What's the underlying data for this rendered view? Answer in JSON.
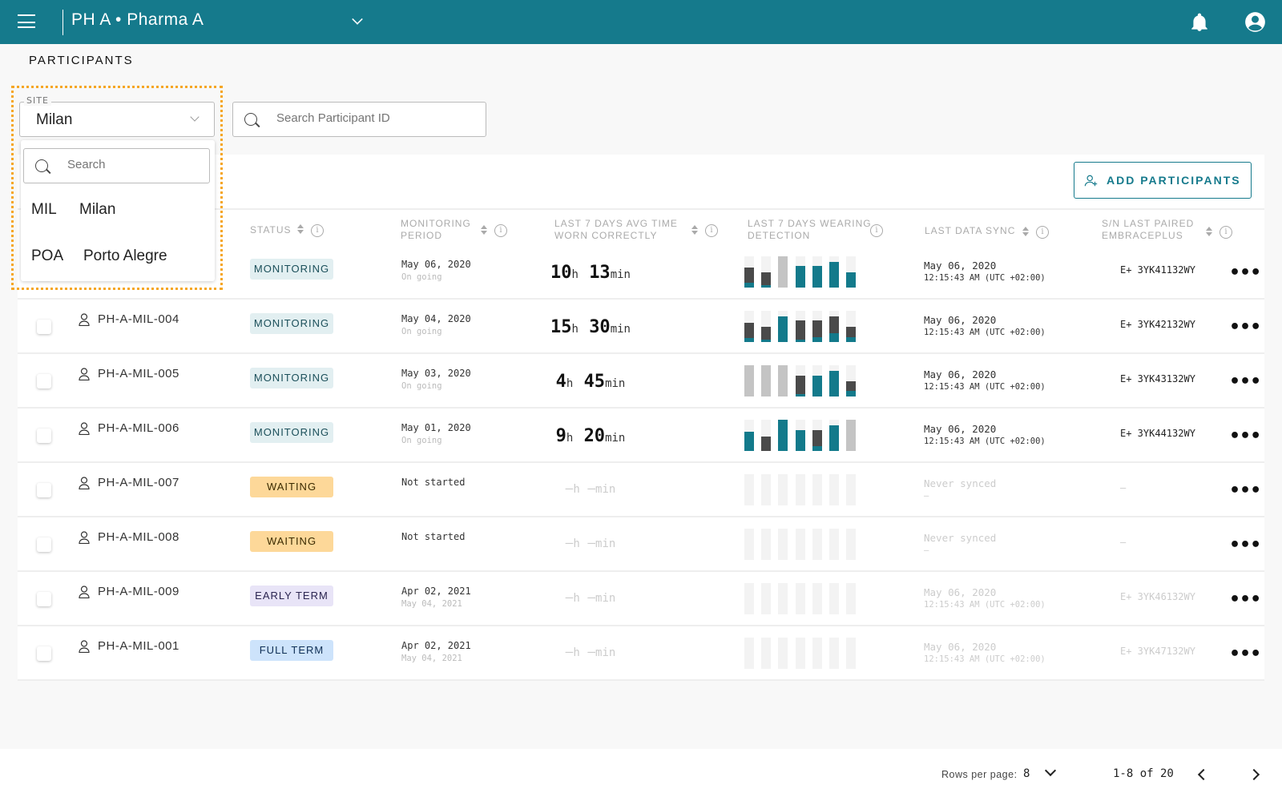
{
  "header": {
    "org": "PH A • Pharma A",
    "menu_icon": "hamburger-icon",
    "notification_icon": "bell-icon",
    "account_icon": "account-circle-icon"
  },
  "page": {
    "title": "PARTICIPANTS"
  },
  "filters": {
    "site_label": "SITE",
    "site_value": "Milan",
    "search_placeholder": "Search Participant ID"
  },
  "site_dropdown": {
    "search_placeholder": "Search",
    "options": [
      {
        "code": "MIL",
        "name": "Milan"
      },
      {
        "code": "POA",
        "name": "Porto Alegre"
      }
    ]
  },
  "toolbar": {
    "add_label": "ADD PARTICIPANTS"
  },
  "columns": {
    "status": "STATUS",
    "monitoring": "MONITORING PERIOD",
    "time_worn": "LAST 7 DAYS AVG TIME WORN CORRECTLY",
    "wearing": "LAST 7 DAYS WEARING DETECTION",
    "sync": "LAST DATA SYNC",
    "sn": "S/N LAST PAIRED EMBRACEPLUS"
  },
  "colors": {
    "brand": "#157a8c",
    "teal": "#137a8b",
    "dark": "#4a4a4a",
    "nodata": "#c4c4c4",
    "highlight": "#f5a623"
  },
  "status_styles": {
    "MONITORING": {
      "bg": "#e2eff1",
      "fg": "#1b4f5a"
    },
    "WAITING": {
      "bg": "#fdd899",
      "fg": "#3a2a00"
    },
    "EARLY TERM": {
      "bg": "#e8e4f7",
      "fg": "#2a2450"
    },
    "FULL TERM": {
      "bg": "#cde3fb",
      "fg": "#0f2f55"
    }
  },
  "rows": [
    {
      "id": "",
      "status": "MONITORING",
      "period": "May 06, 2020",
      "period_sub": "On going",
      "hours": "10",
      "mins": "13",
      "sync": "May 06, 2020",
      "sync_sub": "12:15:43 AM (UTC +02:00)",
      "sn": "E+ 3YK41132WY",
      "dim": false,
      "bars": [
        {
          "total": 0.64,
          "teal": 0.15
        },
        {
          "total": 0.49,
          "teal": 0.08
        },
        {
          "nodata": true
        },
        {
          "total": 0.69,
          "teal": 0.69
        },
        {
          "total": 0.69,
          "teal": 0.69
        },
        {
          "total": 0.83,
          "teal": 0.83
        },
        {
          "total": 0.49,
          "teal": 0.49
        }
      ]
    },
    {
      "id": "PH-A-MIL-004",
      "status": "MONITORING",
      "period": "May 04, 2020",
      "period_sub": "On going",
      "hours": "15",
      "mins": "30",
      "sync": "May 06, 2020",
      "sync_sub": "12:15:43 AM (UTC +02:00)",
      "sn": "E+ 3YK42132WY",
      "dim": false,
      "bars": [
        {
          "total": 0.62,
          "teal": 0.14
        },
        {
          "total": 0.48,
          "teal": 0.09
        },
        {
          "total": 0.82,
          "teal": 0.82
        },
        {
          "total": 0.69,
          "teal": 0.09
        },
        {
          "total": 0.69,
          "teal": 0.15
        },
        {
          "total": 0.82,
          "teal": 0.29
        },
        {
          "total": 0.48,
          "teal": 0.15
        }
      ]
    },
    {
      "id": "PH-A-MIL-005",
      "status": "MONITORING",
      "period": "May 03, 2020",
      "period_sub": "On going",
      "hours": "4",
      "mins": "45",
      "sync": "May 06, 2020",
      "sync_sub": "12:15:43 AM (UTC +02:00)",
      "sn": "E+ 3YK43132WY",
      "dim": false,
      "bars": [
        {
          "nodata": true
        },
        {
          "nodata": true
        },
        {
          "nodata": true
        },
        {
          "total": 0.67,
          "teal": 0.09
        },
        {
          "total": 0.67,
          "teal": 0.67
        },
        {
          "total": 0.82,
          "teal": 0.82
        },
        {
          "total": 0.49,
          "teal": 0.17
        }
      ]
    },
    {
      "id": "PH-A-MIL-006",
      "status": "MONITORING",
      "period": "May 01, 2020",
      "period_sub": "On going",
      "hours": "9",
      "mins": "20",
      "sync": "May 06, 2020",
      "sync_sub": "12:15:43 AM (UTC +02:00)",
      "sn": "E+ 3YK44132WY",
      "dim": false,
      "bars": [
        {
          "total": 0.62,
          "teal": 0.62
        },
        {
          "total": 0.47,
          "teal": 0
        },
        {
          "total": 0.99,
          "teal": 0.99
        },
        {
          "total": 0.67,
          "teal": 0.67
        },
        {
          "total": 0.67,
          "teal": 0.15
        },
        {
          "total": 0.82,
          "teal": 0.82
        },
        {
          "nodata": true
        }
      ]
    },
    {
      "id": "PH-A-MIL-007",
      "status": "WAITING",
      "period": "Not started",
      "period_sub": "",
      "hours": "–",
      "mins": "–",
      "sync": "Never synced",
      "sync_sub": "–",
      "sn": "–",
      "dim": true,
      "bars": []
    },
    {
      "id": "PH-A-MIL-008",
      "status": "WAITING",
      "period": "Not started",
      "period_sub": "",
      "hours": "–",
      "mins": "–",
      "sync": "Never synced",
      "sync_sub": "–",
      "sn": "–",
      "dim": true,
      "bars": []
    },
    {
      "id": "PH-A-MIL-009",
      "status": "EARLY TERM",
      "period": "Apr 02, 2021",
      "period_sub": "May 04, 2021",
      "hours": "–",
      "mins": "–",
      "sync": "May 06, 2020",
      "sync_sub": "12:15:43 AM (UTC +02:00)",
      "sn": "E+ 3YK46132WY",
      "dim": true,
      "bars": []
    },
    {
      "id": "PH-A-MIL-001",
      "status": "FULL TERM",
      "period": "Apr 02, 2021",
      "period_sub": "May 04, 2021",
      "hours": "–",
      "mins": "–",
      "sync": "May 06, 2020",
      "sync_sub": "12:15:43 AM (UTC +02:00)",
      "sn": "E+ 3YK47132WY",
      "dim": true,
      "bars": []
    }
  ],
  "units": {
    "h": "h",
    "min": "min"
  },
  "pagination": {
    "rows_per_page_label": "Rows per page:",
    "rows_per_page": "8",
    "range": "1-8 of 20"
  }
}
